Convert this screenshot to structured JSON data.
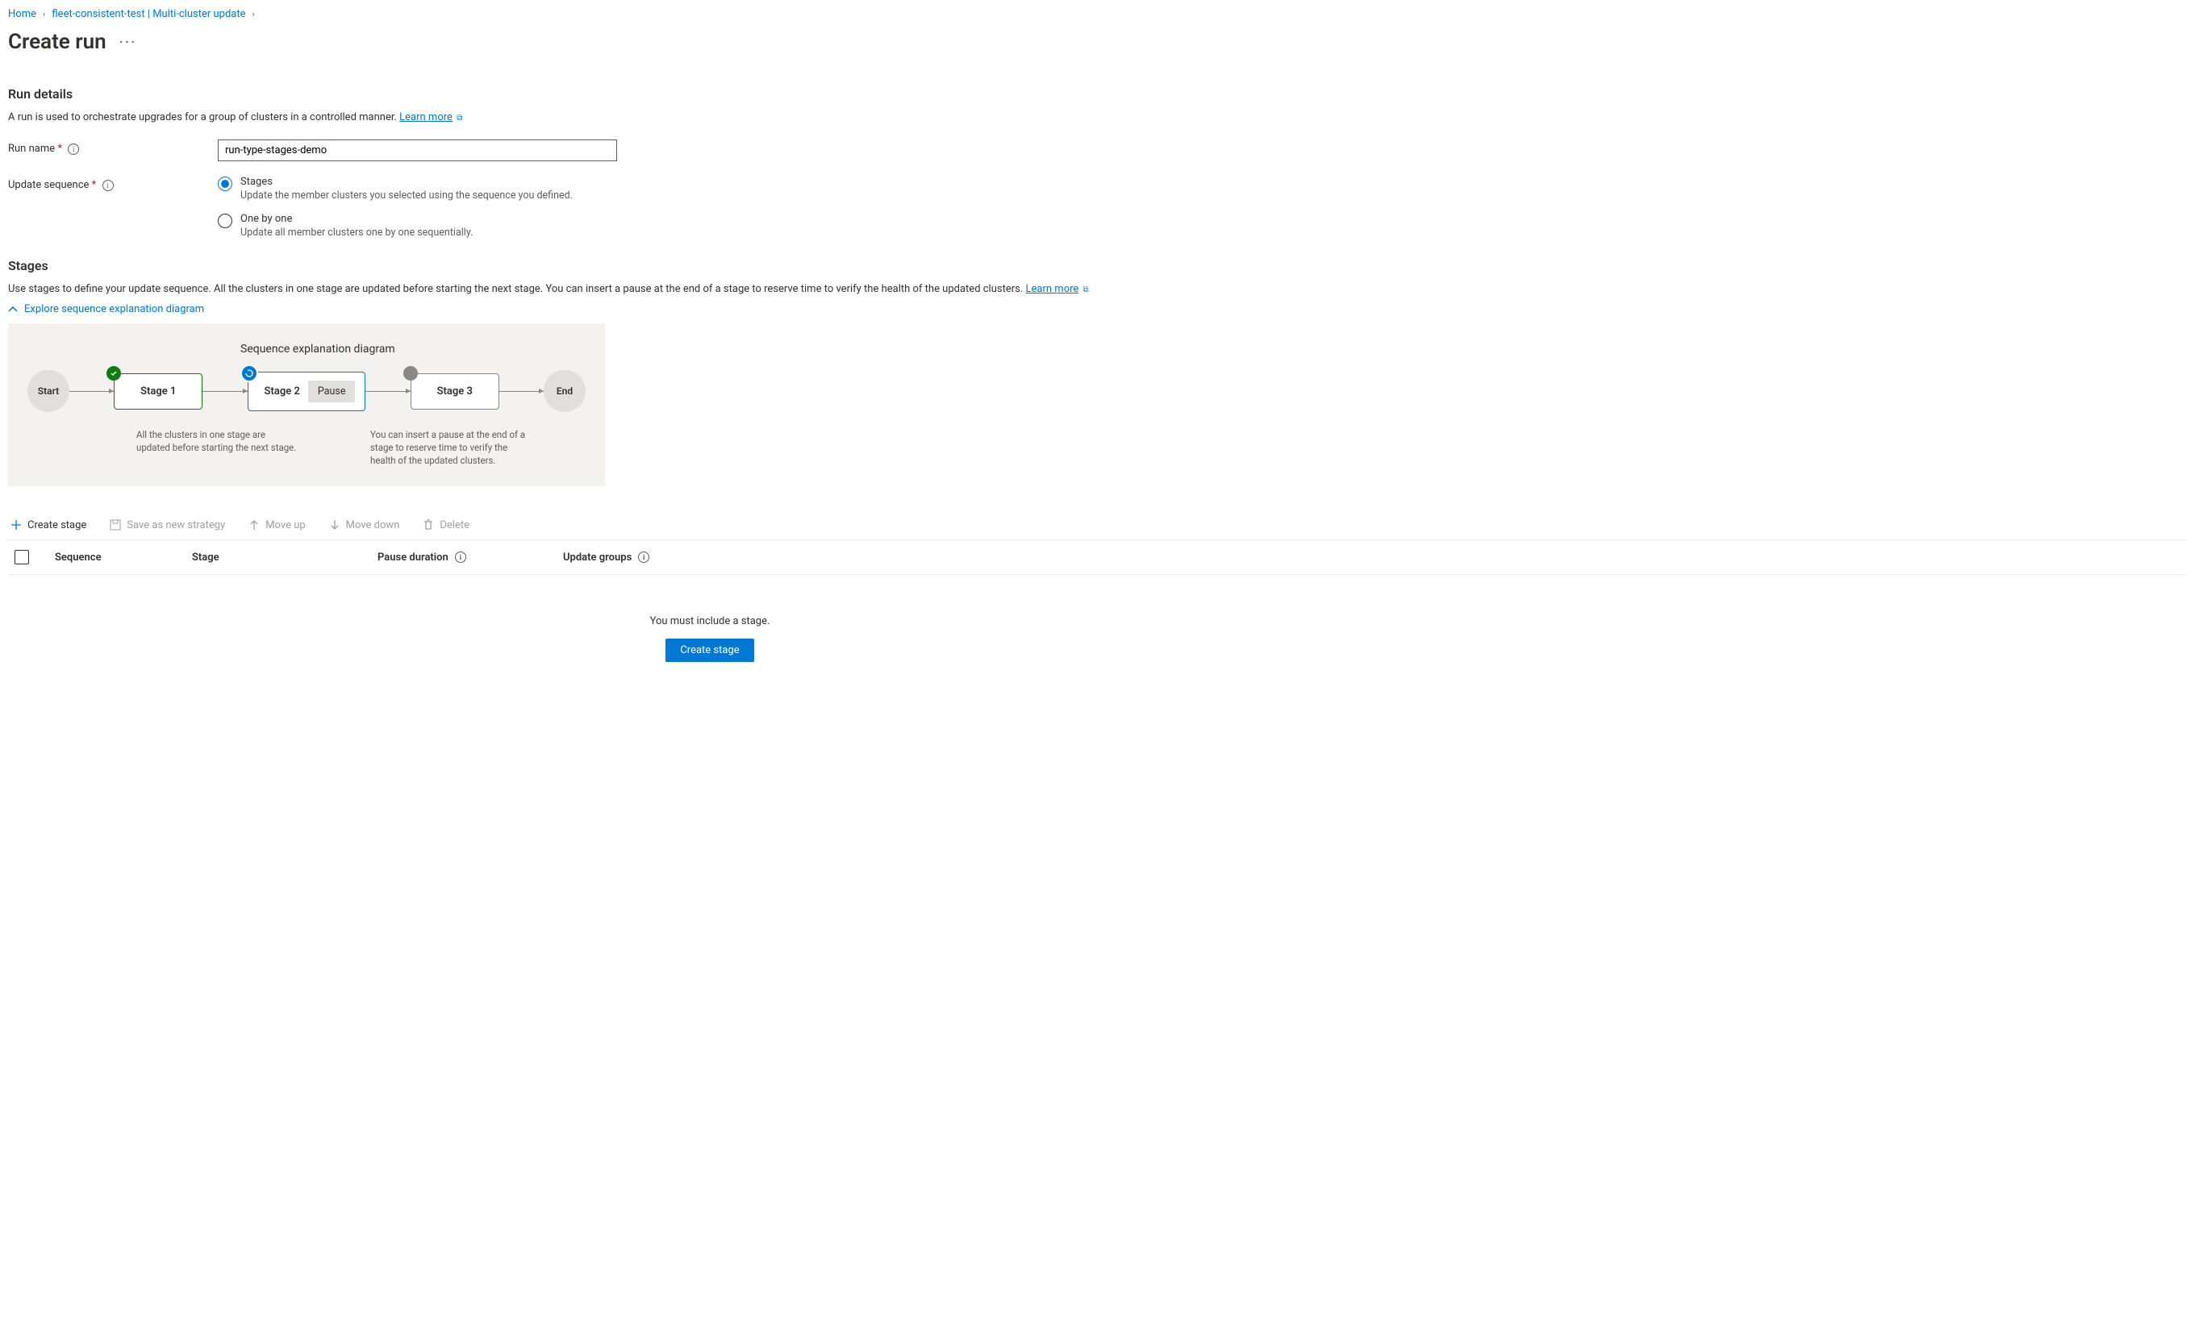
{
  "breadcrumb": {
    "home": "Home",
    "fleet": "fleet-consistent-test | Multi-cluster update"
  },
  "page_title": "Create run",
  "run_details": {
    "heading": "Run details",
    "description": "A run is used to orchestrate upgrades for a group of clusters in a controlled manner.",
    "learn_more": "Learn more",
    "run_name_label": "Run name",
    "run_name_value": "run-type-stages-demo",
    "update_sequence_label": "Update sequence",
    "radio": {
      "stages": {
        "title": "Stages",
        "desc": "Update the member clusters you selected using the sequence you defined."
      },
      "one_by_one": {
        "title": "One by one",
        "desc": "Update all member clusters one by one sequentially."
      }
    }
  },
  "stages": {
    "heading": "Stages",
    "description": "Use stages to define your update sequence. All the clusters in one stage are updated before starting the next stage. You can insert a pause at the end of a stage to reserve time to verify the health of the updated clusters.",
    "learn_more": "Learn more",
    "explore_toggle": "Explore sequence explanation diagram",
    "diagram": {
      "title": "Sequence explanation diagram",
      "start": "Start",
      "stage1": "Stage 1",
      "stage2": "Stage 2",
      "pause": "Pause",
      "stage3": "Stage 3",
      "end": "End",
      "caption1": "All the clusters in one stage are updated before starting the next stage.",
      "caption2": "You can insert a pause at the end of a stage to reserve time to verify the health of the updated clusters."
    }
  },
  "toolbar": {
    "create_stage": "Create stage",
    "save_strategy": "Save as new strategy",
    "move_up": "Move up",
    "move_down": "Move down",
    "delete": "Delete"
  },
  "table": {
    "sequence": "Sequence",
    "stage": "Stage",
    "pause_duration": "Pause duration",
    "update_groups": "Update groups"
  },
  "empty": {
    "message": "You must include a stage.",
    "button": "Create stage"
  }
}
